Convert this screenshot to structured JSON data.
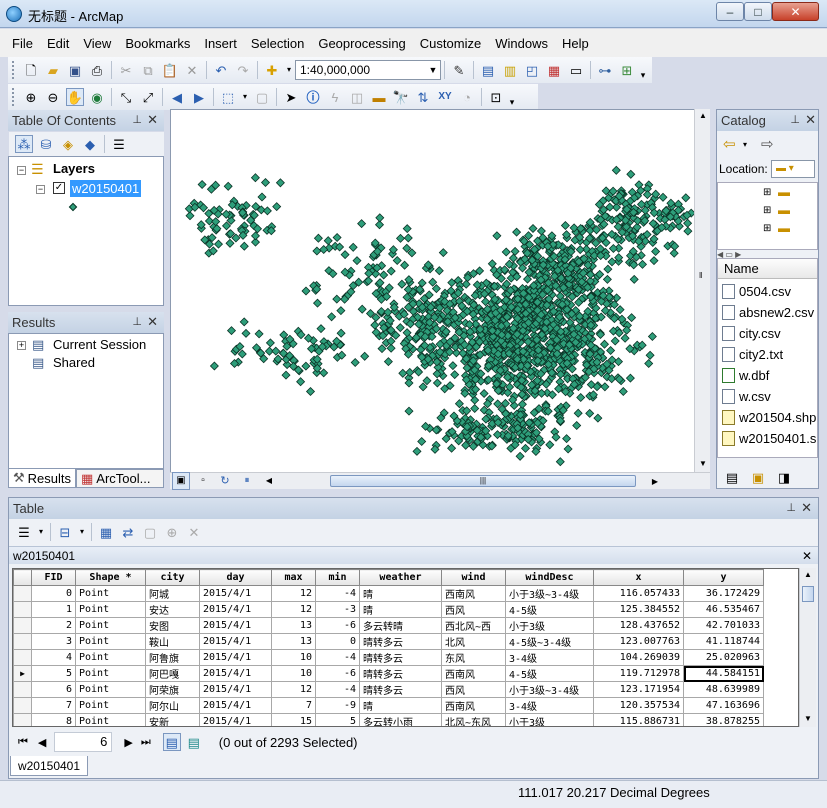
{
  "window": {
    "title": "无标题 - ArcMap",
    "min": "–",
    "max": "□",
    "close": "✕"
  },
  "menu": [
    "File",
    "Edit",
    "View",
    "Bookmarks",
    "Insert",
    "Selection",
    "Geoprocessing",
    "Customize",
    "Windows",
    "Help"
  ],
  "toolbar": {
    "scale": "1:40,000,000"
  },
  "toc": {
    "title": "Table Of Contents",
    "layers_label": "Layers",
    "layer_name": "w20150401"
  },
  "results": {
    "title": "Results",
    "items": [
      "Current Session",
      "Shared"
    ],
    "tab_results": "Results",
    "tab_arctoolbox": "ArcTool..."
  },
  "catalog": {
    "title": "Catalog",
    "location_label": "Location:",
    "name_header": "Name",
    "files": [
      {
        "name": "0504.csv",
        "kind": "csv"
      },
      {
        "name": "absnew2.csv",
        "kind": "csv"
      },
      {
        "name": "city.csv",
        "kind": "csv"
      },
      {
        "name": "city2.txt",
        "kind": "csv"
      },
      {
        "name": "w.dbf",
        "kind": "dbf"
      },
      {
        "name": "w.csv",
        "kind": "csv"
      },
      {
        "name": "w201504.shp",
        "kind": "shp"
      },
      {
        "name": "w20150401.s",
        "kind": "shp"
      }
    ]
  },
  "table": {
    "panel_title": "Table",
    "tab_title": "w20150401",
    "columns": [
      "FID",
      "Shape *",
      "city",
      "day",
      "max",
      "min",
      "weather",
      "wind",
      "windDesc",
      "x",
      "y"
    ],
    "rows": [
      [
        "0",
        "Point",
        "阿城",
        "2015/4/1",
        "12",
        "-4",
        "晴",
        "西南风",
        "小于3级~3-4级",
        "116.057433",
        "36.172429"
      ],
      [
        "1",
        "Point",
        "安达",
        "2015/4/1",
        "12",
        "-3",
        "晴",
        "西风",
        "4-5级",
        "125.384552",
        "46.535467"
      ],
      [
        "2",
        "Point",
        "安图",
        "2015/4/1",
        "13",
        "-6",
        "多云转晴",
        "西北风~西",
        "小于3级",
        "128.437652",
        "42.701033"
      ],
      [
        "3",
        "Point",
        "鞍山",
        "2015/4/1",
        "13",
        "0",
        "晴转多云",
        "北风",
        "4-5级~3-4级",
        "123.007763",
        "41.118744"
      ],
      [
        "4",
        "Point",
        "阿鲁旗",
        "2015/4/1",
        "10",
        "-4",
        "晴转多云",
        "东风",
        "3-4级",
        "104.269039",
        "25.020963"
      ],
      [
        "5",
        "Point",
        "阿巴嘎",
        "2015/4/1",
        "10",
        "-6",
        "晴转多云",
        "西南风",
        "4-5级",
        "119.712978",
        "44.584151"
      ],
      [
        "6",
        "Point",
        "阿荣旗",
        "2015/4/1",
        "12",
        "-4",
        "晴转多云",
        "西风",
        "小于3级~3-4级",
        "123.171954",
        "48.639989"
      ],
      [
        "7",
        "Point",
        "阿尔山",
        "2015/4/1",
        "7",
        "-9",
        "晴",
        "西南风",
        "3-4级",
        "120.357534",
        "47.163696"
      ],
      [
        "8",
        "Point",
        "安新",
        "2015/4/1",
        "15",
        "5",
        "多云转小雨",
        "北风~东风",
        "小于3级",
        "115.886731",
        "38.878255"
      ]
    ],
    "current_record": "6",
    "selection_status": "(0 out of 2293 Selected)",
    "bottom_tab": "w20150401"
  },
  "status": {
    "coords": "111.017  20.217 Decimal Degrees"
  },
  "colors": {
    "point_fill": "#2e9e7a",
    "point_stroke": "#0b3326",
    "selection": "#3399ff"
  }
}
